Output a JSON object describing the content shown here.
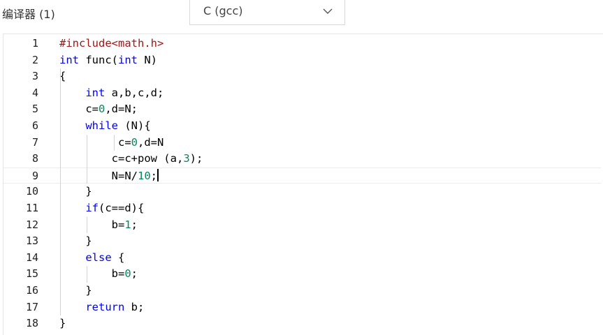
{
  "toolbar": {
    "compiler_label": "编译器 (1)",
    "language_select_value": "C (gcc)",
    "dropdown_icon": "chevron-down-icon"
  },
  "editor": {
    "current_line": 9,
    "lines": [
      {
        "number": "1",
        "tokens": [
          {
            "t": "#include<math.h>",
            "c": "inc"
          }
        ]
      },
      {
        "number": "2",
        "tokens": [
          {
            "t": "int",
            "c": "kw"
          },
          {
            "t": " func(",
            "c": ""
          },
          {
            "t": "int",
            "c": "kw"
          },
          {
            "t": " N)",
            "c": ""
          }
        ]
      },
      {
        "number": "3",
        "tokens": [
          {
            "t": "{",
            "c": ""
          }
        ]
      },
      {
        "number": "4",
        "tokens": [
          {
            "t": "    ",
            "c": ""
          },
          {
            "t": "int",
            "c": "kw"
          },
          {
            "t": " a,b,c,d;",
            "c": ""
          }
        ]
      },
      {
        "number": "5",
        "tokens": [
          {
            "t": "    c=",
            "c": ""
          },
          {
            "t": "0",
            "c": "num"
          },
          {
            "t": ",d=N;",
            "c": ""
          }
        ]
      },
      {
        "number": "6",
        "tokens": [
          {
            "t": "    ",
            "c": ""
          },
          {
            "t": "while",
            "c": "kw"
          },
          {
            "t": " (N){",
            "c": ""
          }
        ]
      },
      {
        "number": "7",
        "tokens": [
          {
            "t": "         c=",
            "c": ""
          },
          {
            "t": "0",
            "c": "num"
          },
          {
            "t": ",d=N",
            "c": ""
          }
        ]
      },
      {
        "number": "8",
        "tokens": [
          {
            "t": "        c=c+pow (a,",
            "c": ""
          },
          {
            "t": "3",
            "c": "num"
          },
          {
            "t": ");",
            "c": ""
          }
        ]
      },
      {
        "number": "9",
        "tokens": [
          {
            "t": "        N=N/",
            "c": ""
          },
          {
            "t": "10",
            "c": "num"
          },
          {
            "t": ";",
            "c": ""
          }
        ]
      },
      {
        "number": "10",
        "tokens": [
          {
            "t": "    }",
            "c": ""
          }
        ]
      },
      {
        "number": "11",
        "tokens": [
          {
            "t": "    ",
            "c": ""
          },
          {
            "t": "if",
            "c": "kw"
          },
          {
            "t": "(c==d){",
            "c": ""
          }
        ]
      },
      {
        "number": "12",
        "tokens": [
          {
            "t": "        b=",
            "c": ""
          },
          {
            "t": "1",
            "c": "num"
          },
          {
            "t": ";",
            "c": ""
          }
        ]
      },
      {
        "number": "13",
        "tokens": [
          {
            "t": "    }",
            "c": ""
          }
        ]
      },
      {
        "number": "14",
        "tokens": [
          {
            "t": "    ",
            "c": ""
          },
          {
            "t": "else",
            "c": "kw"
          },
          {
            "t": " {",
            "c": ""
          }
        ]
      },
      {
        "number": "15",
        "tokens": [
          {
            "t": "        b=",
            "c": ""
          },
          {
            "t": "0",
            "c": "num"
          },
          {
            "t": ";",
            "c": ""
          }
        ]
      },
      {
        "number": "16",
        "tokens": [
          {
            "t": "    }",
            "c": ""
          }
        ]
      },
      {
        "number": "17",
        "tokens": [
          {
            "t": "    ",
            "c": ""
          },
          {
            "t": "return",
            "c": "kw"
          },
          {
            "t": " b;",
            "c": ""
          }
        ]
      },
      {
        "number": "18",
        "tokens": [
          {
            "t": "}",
            "c": ""
          }
        ]
      }
    ]
  }
}
